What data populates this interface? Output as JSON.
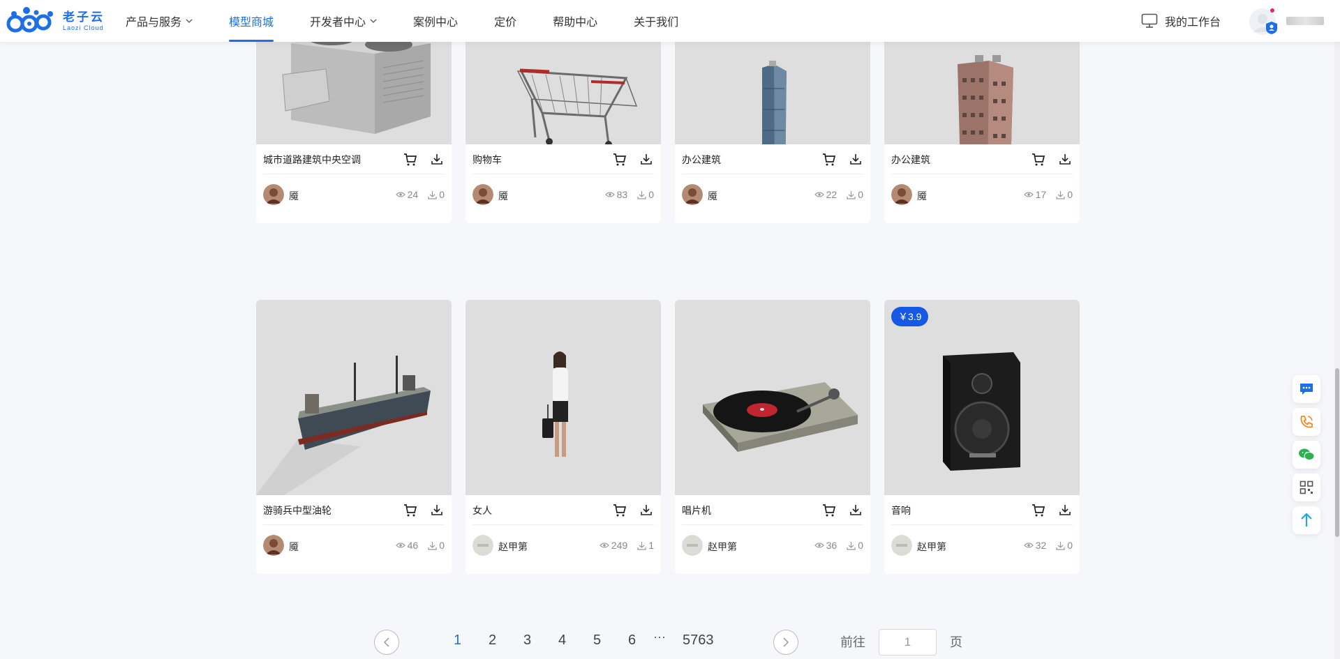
{
  "header": {
    "logo": {
      "cn": "老子云",
      "en": "Laozi Cloud"
    },
    "nav": [
      {
        "label": "产品与服务",
        "dropdown": true,
        "active": false
      },
      {
        "label": "模型商城",
        "dropdown": false,
        "active": true
      },
      {
        "label": "开发者中心",
        "dropdown": true,
        "active": false
      },
      {
        "label": "案例中心",
        "dropdown": false,
        "active": false
      },
      {
        "label": "定价",
        "dropdown": false,
        "active": false
      },
      {
        "label": "帮助中心",
        "dropdown": false,
        "active": false
      },
      {
        "label": "关于我们",
        "dropdown": false,
        "active": false
      }
    ],
    "workbench_label": "我的工作台",
    "workbench_icon": "monitor-icon",
    "avatar_icon": "user-avatar-icon"
  },
  "cards": [
    {
      "title": "城市道路建筑中央空调",
      "author": "魇",
      "views": "24",
      "downloads": "0",
      "image": "air-conditioner-model",
      "price": ""
    },
    {
      "title": "购物车",
      "author": "魇",
      "views": "83",
      "downloads": "0",
      "image": "shopping-cart-model",
      "price": ""
    },
    {
      "title": "办公建筑",
      "author": "魇",
      "views": "22",
      "downloads": "0",
      "image": "office-tower-model",
      "price": ""
    },
    {
      "title": "办公建筑",
      "author": "魇",
      "views": "17",
      "downloads": "0",
      "image": "apartment-tower-model",
      "price": ""
    },
    {
      "title": "游骑兵中型油轮",
      "author": "魇",
      "views": "46",
      "downloads": "0",
      "image": "tanker-ship-model",
      "price": ""
    },
    {
      "title": "女人",
      "author": "赵甲第",
      "views": "249",
      "downloads": "1",
      "image": "woman-model",
      "price": ""
    },
    {
      "title": "唱片机",
      "author": "赵甲第",
      "views": "36",
      "downloads": "0",
      "image": "turntable-model",
      "price": ""
    },
    {
      "title": "音响",
      "author": "赵甲第",
      "views": "32",
      "downloads": "0",
      "image": "speaker-model",
      "price": "￥3.9"
    }
  ],
  "pagination": {
    "pages": [
      "1",
      "2",
      "3",
      "4",
      "5",
      "6"
    ],
    "current": "1",
    "ellipsis": "···",
    "last": "5763",
    "goto_prefix": "前往",
    "goto_value": "1",
    "goto_suffix": "页"
  },
  "side_bar": [
    "chat-icon",
    "phone-icon",
    "wechat-icon",
    "qrcode-icon",
    "back-to-top-icon"
  ],
  "colors": {
    "accent": "#1e6fe3",
    "price_badge": "#1657e6",
    "background": "#f5f7fb"
  }
}
